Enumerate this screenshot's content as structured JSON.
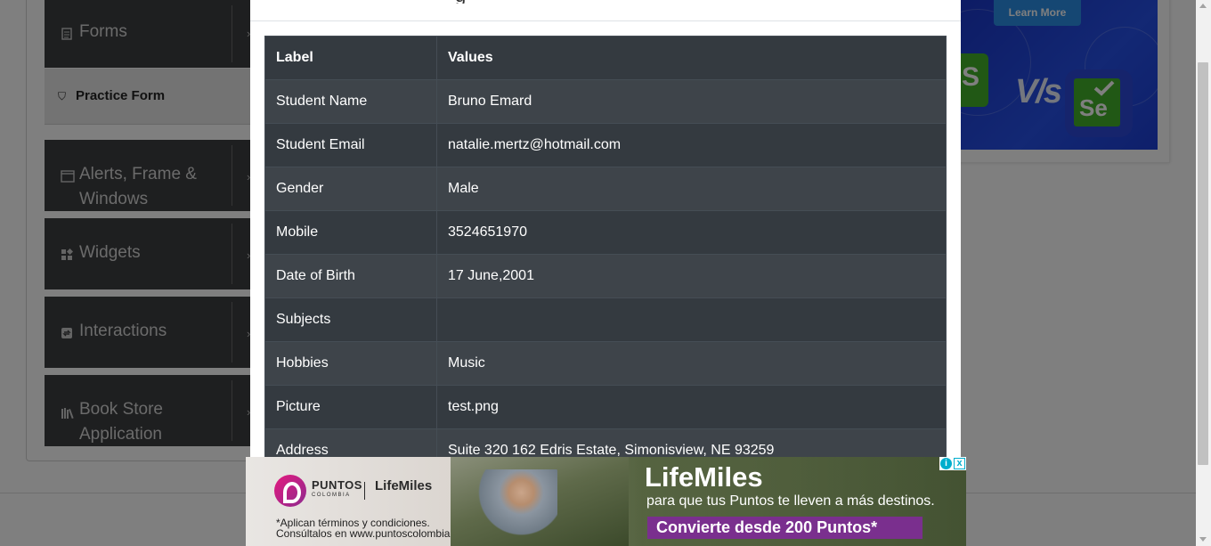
{
  "sidebar": {
    "groups": [
      {
        "label": "Forms",
        "icon": "document-icon"
      },
      {
        "label": "Alerts, Frame & Windows",
        "icon": "browser-window-icon"
      },
      {
        "label": "Widgets",
        "icon": "widgets-icon"
      },
      {
        "label": "Interactions",
        "icon": "interactions-icon"
      },
      {
        "label": "Book Store Application",
        "icon": "books-icon"
      }
    ],
    "active_item": {
      "label": "Practice Form",
      "icon": "html5-icon"
    },
    "labels_wrapped": {
      "alerts_line1": "Alerts, Frame &",
      "alerts_line2": "Windows",
      "book_line1": "Book Store",
      "book_line2": "Application"
    }
  },
  "right_ad": {
    "button_label": "Learn More",
    "vs_text": "V/s",
    "badge_text": "Se",
    "left_badge_text": "S"
  },
  "modal": {
    "table": {
      "headers": [
        "Label",
        "Values"
      ],
      "rows": [
        {
          "label": "Student Name",
          "value": "Bruno Emard"
        },
        {
          "label": "Student Email",
          "value": "natalie.mertz@hotmail.com"
        },
        {
          "label": "Gender",
          "value": "Male"
        },
        {
          "label": "Mobile",
          "value": "3524651970"
        },
        {
          "label": "Date of Birth",
          "value": "17 June,2001"
        },
        {
          "label": "Subjects",
          "value": ""
        },
        {
          "label": "Hobbies",
          "value": "Music"
        },
        {
          "label": "Picture",
          "value": "test.png"
        },
        {
          "label": "Address",
          "value": "Suite 320 162 Edris Estate, Simonisview, NE 93259"
        }
      ]
    }
  },
  "bottom_ad": {
    "brand": "PUNTOS",
    "brand_sub": "COLOMBIA",
    "partner": "LifeMiles",
    "terms_line1": "*Aplican términos y condiciones.",
    "terms_line2": "Consúltalos en www.puntoscolombia.com",
    "headline": "LifeMiles",
    "tagline": "para que tus Puntos te lleven a más destinos.",
    "cta": "Convierte desde 200 Puntos*",
    "adchoices_i": "i",
    "adchoices_x": "x"
  },
  "colors": {
    "overlay": "#00000080",
    "table_dark": "#343a40",
    "table_stripe": "#3e444a",
    "ad_cta": "#7a2f8e",
    "right_ad_blue": "#2650e8",
    "selenium_green": "#43b02a"
  }
}
